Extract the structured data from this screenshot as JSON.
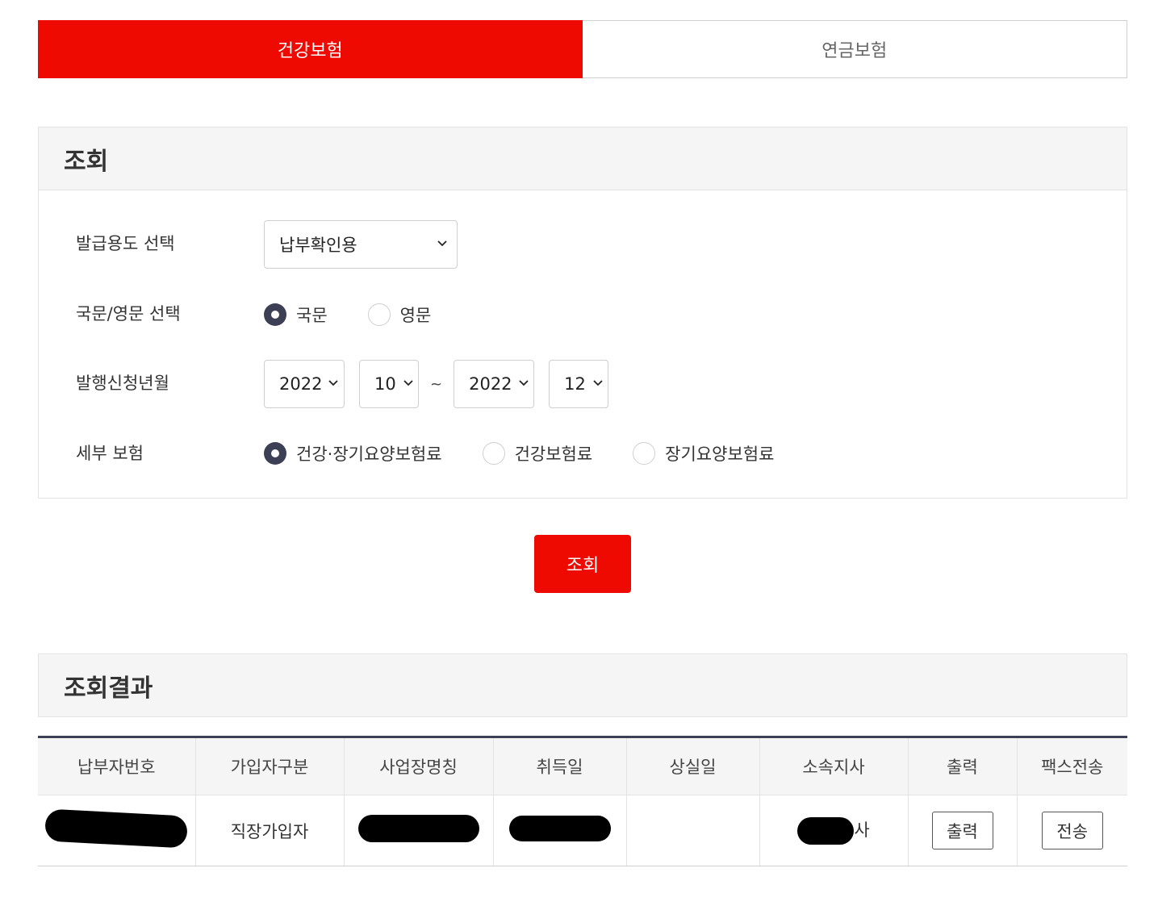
{
  "tabs": [
    {
      "label": "건강보험",
      "active": true
    },
    {
      "label": "연금보험",
      "active": false
    }
  ],
  "search": {
    "title": "조회",
    "purpose_label": "발급용도 선택",
    "purpose_value": "납부확인용",
    "lang_label": "국문/영문 선택",
    "lang_options": [
      {
        "label": "국문",
        "checked": true
      },
      {
        "label": "영문",
        "checked": false
      }
    ],
    "period_label": "발행신청년월",
    "from_year": "2022",
    "from_month": "10",
    "separator": "~",
    "to_year": "2022",
    "to_month": "12",
    "detail_label": "세부 보험",
    "detail_options": [
      {
        "label": "건강·장기요양보험료",
        "checked": true
      },
      {
        "label": "건강보험료",
        "checked": false
      },
      {
        "label": "장기요양보험료",
        "checked": false
      }
    ],
    "submit_label": "조회"
  },
  "result": {
    "title": "조회결과",
    "columns": [
      "납부자번호",
      "가입자구분",
      "사업장명칭",
      "취득일",
      "상실일",
      "소속지사",
      "출력",
      "팩스전송"
    ],
    "row": {
      "member_type": "직장가입자",
      "branch_suffix": "사",
      "print_label": "출력",
      "fax_label": "전송"
    }
  },
  "colors": {
    "accent": "#ee0a00",
    "dark": "#3d3f55",
    "header_bg": "#f5f5f6"
  }
}
